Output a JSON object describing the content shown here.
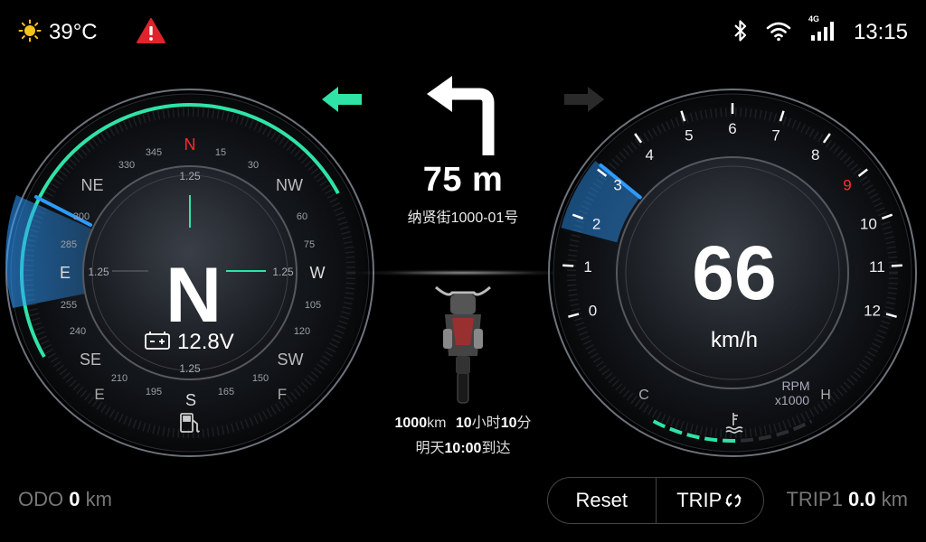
{
  "status": {
    "temperature": "39°C",
    "clock": "13:15",
    "network_label": "4G",
    "icons": [
      "sun-icon",
      "warning-icon",
      "bluetooth-icon",
      "wifi-icon",
      "cellular-signal-icon"
    ],
    "warning_color": "#e0242b"
  },
  "compass": {
    "heading_letter": "N",
    "voltage": "12.8V",
    "cardinals": {
      "n": "N",
      "e": "E",
      "s": "S",
      "w": "W",
      "ne": "NE",
      "nw": "NW",
      "se": "SE",
      "sw": "SW"
    },
    "degree_labels": [
      "345",
      "15",
      "30",
      "330",
      "300",
      "60",
      "285",
      "75",
      "255",
      "105",
      "240",
      "120",
      "210",
      "150",
      "195",
      "165"
    ],
    "inner_labels": {
      "top": "1.25",
      "left": "1.25",
      "right": "1.25",
      "bottom": "1.25"
    },
    "fuel_labels": {
      "empty": "E",
      "full": "F"
    },
    "accent_color": "#2fe3a6",
    "needle_color": "#2e9bff"
  },
  "navigation": {
    "turn_direction": "left",
    "distance": "75 m",
    "street": "纳贤街1000-01号",
    "eta_km_value": "1000",
    "eta_km_unit": "km",
    "eta_hours_value": "10",
    "eta_hours_unit": "小时",
    "eta_minutes_value": "10",
    "eta_minutes_unit": "分",
    "eta_day": "明天",
    "eta_time": "10:00",
    "eta_suffix": "到达",
    "left_signal_active": true,
    "right_signal_active": false
  },
  "speedometer": {
    "speed": "66",
    "unit": "km/h",
    "rpm_label": "RPM",
    "rpm_multiplier": "x1000",
    "rpm_ticks": [
      "0",
      "1",
      "2",
      "3",
      "4",
      "5",
      "6",
      "7",
      "8",
      "9",
      "10",
      "11",
      "12"
    ],
    "rpm_value": 3.1,
    "redline_tick": "9",
    "temp_labels": {
      "cold": "C",
      "hot": "H"
    },
    "temp_level": 0.55,
    "redline_color": "#ff3030"
  },
  "footer": {
    "odo_label": "ODO",
    "odo_value": "0",
    "odo_unit": "km",
    "reset_label": "Reset",
    "trip_label": "TRIP",
    "trip1_label": "TRIP1",
    "trip1_value": "0.0",
    "trip1_unit": "km"
  }
}
